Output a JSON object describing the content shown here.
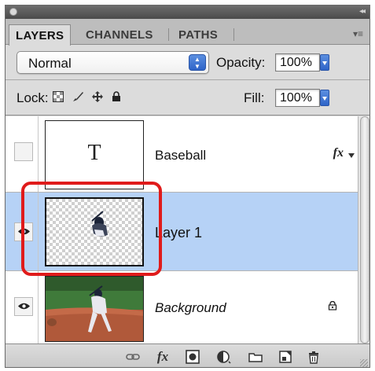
{
  "tabs": [
    {
      "label": "LAYERS",
      "active": true
    },
    {
      "label": "CHANNELS",
      "active": false
    },
    {
      "label": "PATHS",
      "active": false
    }
  ],
  "blend_mode": {
    "value": "Normal"
  },
  "opacity": {
    "label": "Opacity:",
    "value": "100%"
  },
  "lock": {
    "label": "Lock:",
    "icons": [
      "transparent-pixels-icon",
      "brush-icon",
      "move-icon",
      "lock-icon"
    ]
  },
  "fill": {
    "label": "Fill:",
    "value": "100%"
  },
  "layers": [
    {
      "name": "Baseball",
      "type": "text",
      "thumb_glyph": "T",
      "visible": false,
      "selected": false,
      "has_fx": true,
      "fx_label": "fx",
      "locked": false
    },
    {
      "name": "Layer 1",
      "type": "image",
      "visible": true,
      "selected": true,
      "has_fx": false,
      "locked": false
    },
    {
      "name": "Background",
      "type": "photo",
      "visible": true,
      "selected": false,
      "has_fx": false,
      "locked": true
    }
  ],
  "bottom_toolbar": {
    "fx_label": "fx",
    "icons": [
      "link-layers-icon",
      "fx-icon",
      "layer-mask-icon",
      "adjustment-layer-icon",
      "new-group-icon",
      "new-layer-icon",
      "trash-icon"
    ]
  },
  "colors": {
    "selection": "#b6d2f6",
    "highlight": "#e01b1b",
    "accent": "#2f64c8"
  }
}
